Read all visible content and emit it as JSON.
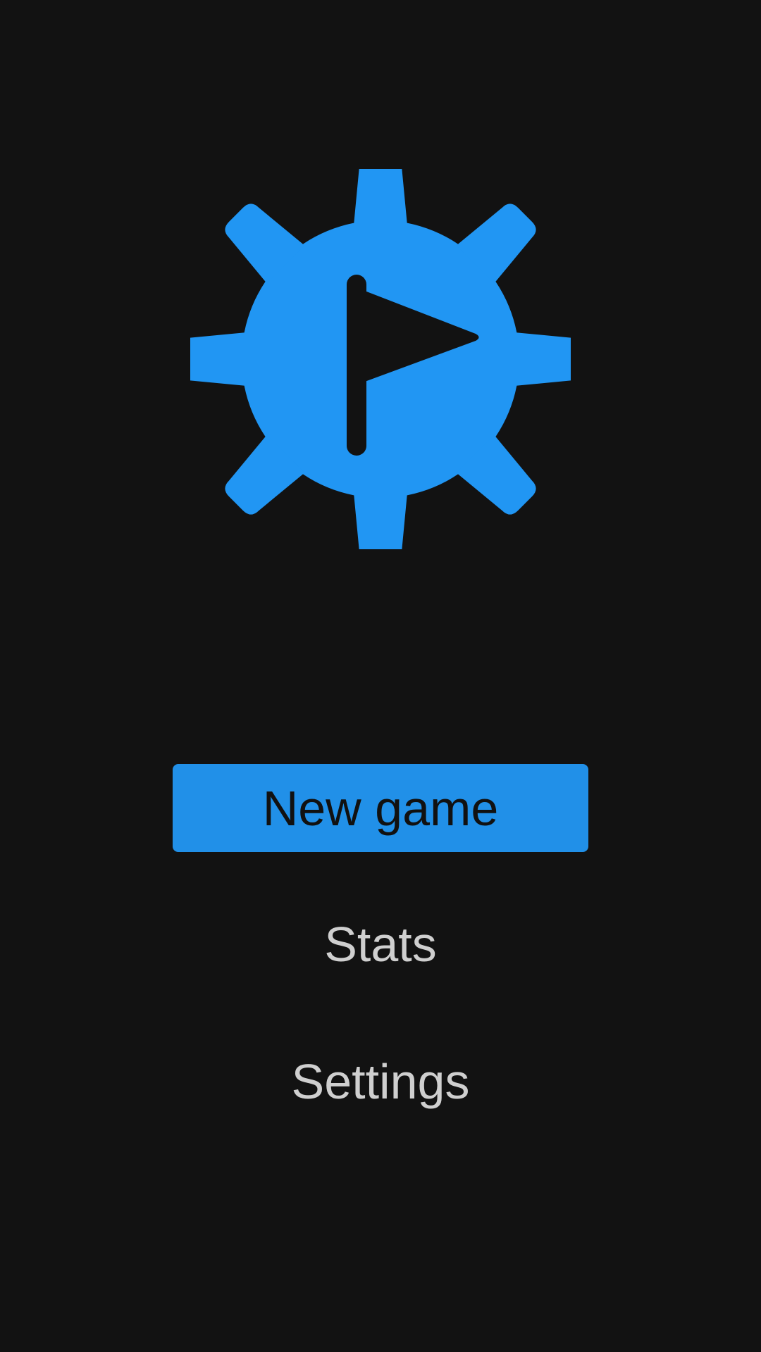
{
  "app": {
    "logo_icon": "gear-flag-icon",
    "accent_color": "#2196f3",
    "background_color": "#121212"
  },
  "menu": {
    "new_game_label": "New game",
    "stats_label": "Stats",
    "settings_label": "Settings"
  }
}
